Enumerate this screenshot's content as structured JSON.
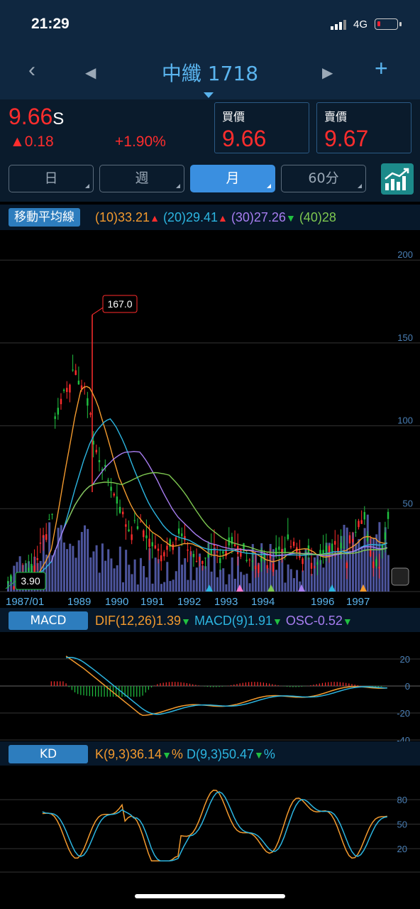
{
  "status": {
    "time": "21:29",
    "network": "4G"
  },
  "nav": {
    "back": "‹",
    "prev": "◀",
    "title": "中纖 1718",
    "next": "▶",
    "add": "+"
  },
  "quote": {
    "price": "9.66",
    "price_suffix": "S",
    "change": "▲0.18",
    "change_pct": "+1.90%",
    "bid_label": "買價",
    "bid_value": "9.66",
    "ask_label": "賣價",
    "ask_value": "9.67"
  },
  "periods": [
    {
      "label": "日",
      "active": false
    },
    {
      "label": "週",
      "active": false
    },
    {
      "label": "月",
      "active": true
    },
    {
      "label": "60分",
      "active": false
    }
  ],
  "ma": {
    "tag": "移動平均線",
    "items": [
      {
        "text": "(10)33.21",
        "arrow": "▲",
        "color": "#f39a2e"
      },
      {
        "text": "(20)29.41",
        "arrow": "▲",
        "color": "#2cb5e0"
      },
      {
        "text": "(30)27.26",
        "arrow": "▼",
        "color": "#a77df0"
      },
      {
        "text": "(40)28",
        "arrow": "",
        "color": "#7ec850"
      }
    ]
  },
  "price_chart": {
    "y_ticks": [
      "200",
      "150",
      "100",
      "50"
    ],
    "x_labels": [
      "1987/01",
      "1989",
      "1990",
      "1991",
      "1992",
      "1993",
      "1994",
      "1996",
      "1997"
    ],
    "high_label": "167.0",
    "low_label": "3.90"
  },
  "macd": {
    "tag": "MACD",
    "dif": "DIF(12,26)1.39",
    "dif_arrow": "▼",
    "macd": "MACD(9)1.91",
    "macd_arrow": "▼",
    "osc": "OSC-0.52",
    "osc_arrow": "▼",
    "y_ticks": [
      "20",
      "0",
      "-20",
      "-40"
    ]
  },
  "kd": {
    "tag": "KD",
    "k": "K(9,3)36.14",
    "k_arrow": "▼",
    "k_unit": "%",
    "d": "D(9,3)50.47",
    "d_arrow": "▼",
    "d_unit": "%",
    "y_ticks": [
      "80",
      "50",
      "20"
    ]
  },
  "colors": {
    "up": "#ff2d2d",
    "down": "#20c040",
    "accent": "#3a8fe0",
    "dif": "#f39a2e",
    "macd": "#2cb5e0",
    "osc": "#a77df0"
  }
}
